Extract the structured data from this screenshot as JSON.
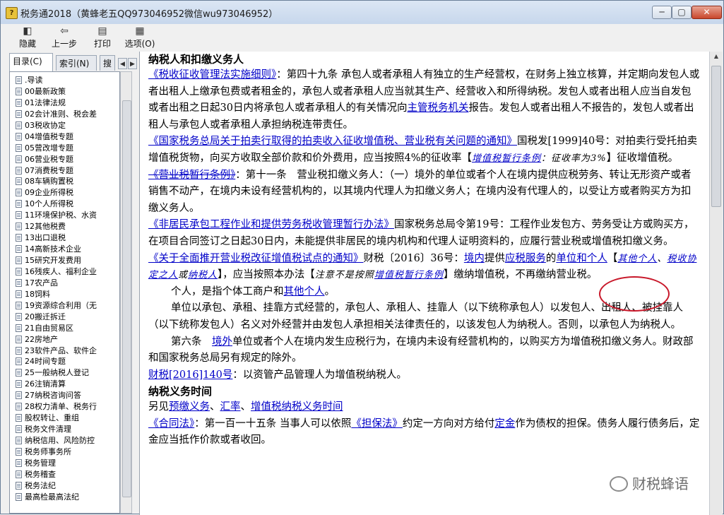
{
  "window": {
    "title": "税务通2018（黄蜂老五QQ973046952微信wu973046952）",
    "app_icon": "?",
    "controls": {
      "minimize": "─",
      "maximize": "▢",
      "close": "✕"
    }
  },
  "toolbar": {
    "hide": "隐藏",
    "back": "上一步",
    "print": "打印",
    "options": "选项(O)"
  },
  "left_tabs": {
    "contents": "目录(C)",
    "index": "索引(N)",
    "search": "搜",
    "arrow_left": "◀",
    "arrow_right": "▶"
  },
  "tree": [
    ".导读",
    "00最新政策",
    "01法律法规",
    "02会计准则、税会差",
    "03税收协定",
    "04增值税专题",
    "05营改增专题",
    "06营业税专题",
    "07消费税专题",
    "08车辆购置税",
    "09企业所得税",
    "10个人所得税",
    "11环境保护税、水资",
    "12其他税费",
    "13出口退税",
    "14高新技术企业",
    "15研究开发费用",
    "16残疾人、福利企业",
    "17农产品",
    "18饲料",
    "19资源综合利用（无",
    "20搬迁拆迁",
    "21自由贸易区",
    "22房地产",
    "23软件产品、软件企",
    "24时间专题",
    "25一般纳税人登记",
    "26注销清算",
    "27纳税咨询问答",
    "28权力清单、税务行",
    "股权转让、重组",
    "税务文件清理",
    "纳税信用、风险防控",
    "税务师事务所",
    "税务管理",
    "税务稽查",
    "税务法纪",
    "最高检最高法纪"
  ],
  "content": {
    "h1": "纳税人和扣缴义务人",
    "p1": {
      "link": "《税收征收管理法实施细则》",
      "t1": "：第四十九条 承包人或者承租人有独立的生产经营权，在财务上独立核算，并定期向发包人或者出租人上缴承包费或者租金的，承包人或者承租人应当就其生产、经营收入和所得纳税。发包人或者出租人应当自发包或者出租之日起30日内将承包人或者承租人的有关情况向",
      "link2": "主管税务机关",
      "t2": "报告。发包人或者出租人不报告的，发包人或者出租人与承包人或者承租人承担纳税连带责任。"
    },
    "p2": {
      "link": "《国家税务总局关于拍卖行取得的拍卖收入征收增值税、营业税有关问题的通知》",
      "t1": "国税发[1999]40号：对拍卖行受托拍卖增值税货物，向买方收取全部价款和价外费用，应当按照4%的征收率【",
      "link2": "增值税暂行条例",
      "note": "：征收率为3%",
      "t2": "】征收增值税。"
    },
    "p3": {
      "link": "《营业税暂行条例》",
      "t1": "：第十一条　营业税扣缴义务人：（一）境外的单位或者个人在境内提供应税劳务、转让无形资产或者销售不动产，在境内未设有经营机构的，以其境内代理人为扣缴义务人；在境内没有代理人的，以受让方或者购买方为扣缴义务人。"
    },
    "p4": {
      "link": "《非居民承包工程作业和提供劳务税收管理暂行办法》",
      "t1": "国家税务总局令第19号：工程作业发包方、劳务受让方或购买方，在项目合同签订之日起30日内，未能提供非居民的境内机构和代理人证明资料的，应履行营业税或增值税扣缴义务。"
    },
    "p5": {
      "link": "《关于全面推开营业税改征增值税试点的通知》",
      "t1": "财税〔2016〕36号：",
      "link2": "境内",
      "t2": "提供",
      "link3": "应税服务",
      "t3": "的",
      "link4": "单位和个人",
      "t4": "【",
      "link5": "其他个人",
      "t5": "、",
      "link6": "税收协定之人",
      "t6": "或",
      "link7": "纳税人",
      "t7": "】，应当按照本办法【",
      "note": "注意不是按照",
      "link8": "增值税暂行条例",
      "t8": "】缴纳增值税，不再缴纳营业税。"
    },
    "p6": {
      "t1": "个人，是指个体工商户和",
      "link": "其他个人",
      "t2": "。"
    },
    "p7": "单位以承包、承租、挂靠方式经营的，承包人、承租人、挂靠人（以下统称承包人）以发包人、出租人、被挂靠人（以下统称发包人）名义对外经营并由发包人承担相关法律责任的，以该发包人为纳税人。否则，以承包人为纳税人。",
    "p8": {
      "t1": "第六条　",
      "link": "境外",
      "t2": "单位或者个人在境内发生应税行为，在境内未设有经营机构的，以购买方为增值税扣缴义务人。财政部和国家税务总局另有规定的除外。"
    },
    "p9": {
      "link": "财税[2016]140号",
      "t1": "：以资管产品管理人为增值税纳税人。"
    },
    "h2": "纳税义务时间",
    "p10": {
      "t1": "另见",
      "link": "预缴义务",
      "t2": "、",
      "link2": "汇率",
      "t3": "、",
      "link3": "增值税纳税义务时间"
    },
    "p11": {
      "link": "《合同法》",
      "t1": "：第一百一十五条 当事人可以依照",
      "link2": "《担保法》",
      "t2": "约定一方向对方给付",
      "link3": "定金",
      "t3": "作为债权的担保。债务人履行债务后，定金应当抵作价款或者收回。"
    }
  },
  "watermark": "财税蜂语"
}
